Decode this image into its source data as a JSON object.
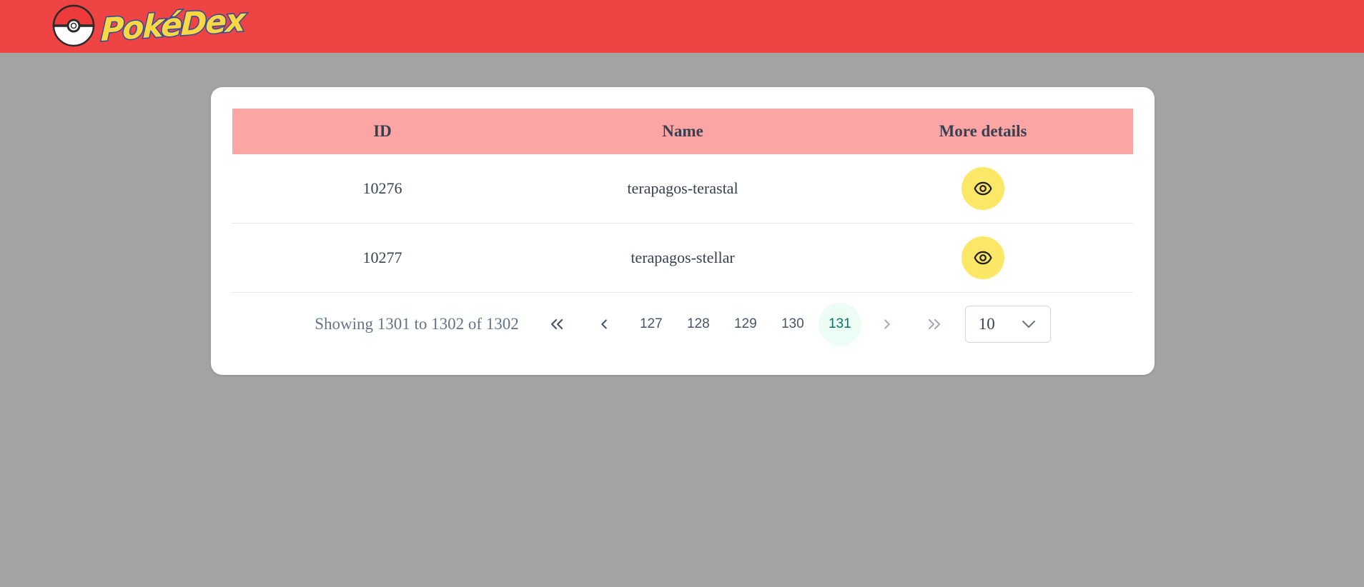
{
  "header": {
    "logo_text": "PokéDex",
    "bg_color": "#ef4444"
  },
  "table": {
    "columns": [
      "ID",
      "Name",
      "More details"
    ],
    "rows": [
      {
        "id": "10276",
        "name": "terapagos-terastal",
        "action_icon": "eye-icon"
      },
      {
        "id": "10277",
        "name": "terapagos-stellar",
        "action_icon": "eye-icon"
      }
    ],
    "header_color": "#fca5a5",
    "action_color": "#fde767"
  },
  "pagination": {
    "summary": "Showing 1301 to 1302 of 1302",
    "pages": [
      "127",
      "128",
      "129",
      "130",
      "131"
    ],
    "current_page": "131",
    "page_size": "10",
    "first_icon": "double-chevron-left-icon",
    "prev_icon": "chevron-left-icon",
    "next_icon": "chevron-right-icon",
    "last_icon": "double-chevron-right-icon"
  }
}
